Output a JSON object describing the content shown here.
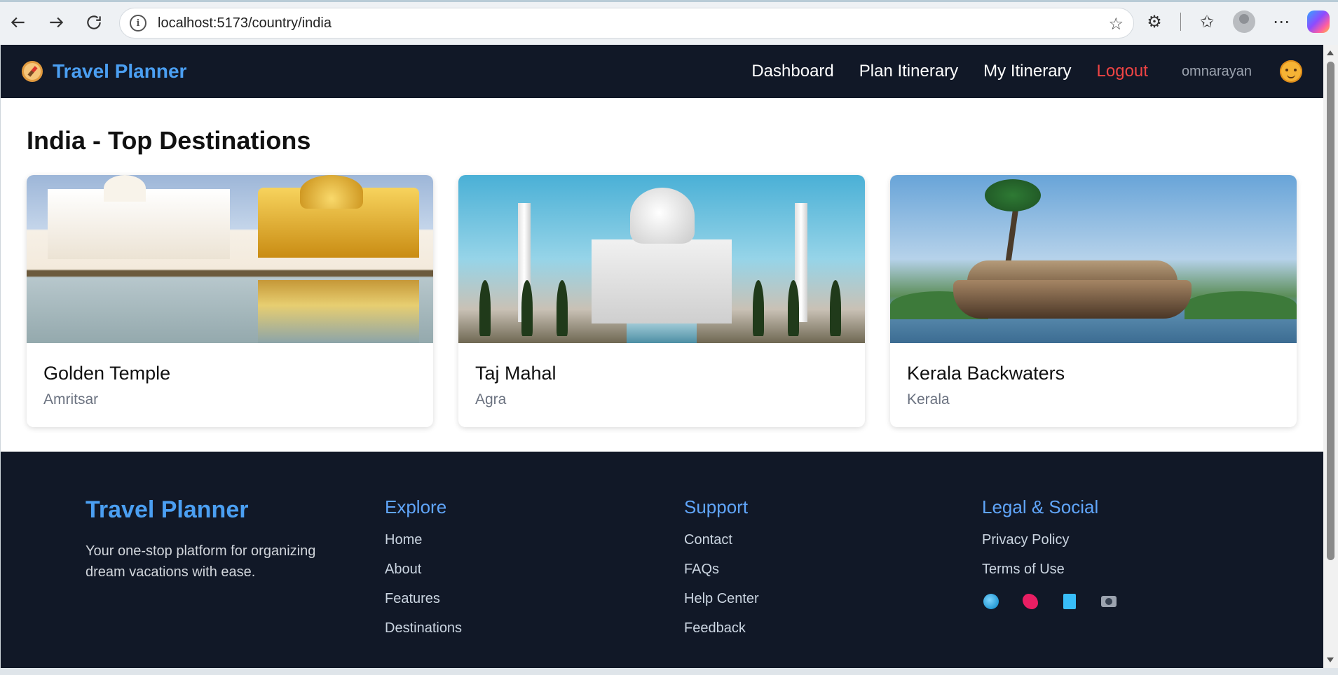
{
  "browser": {
    "url": "localhost:5173/country/india"
  },
  "app_nav": {
    "brand": "Travel Planner",
    "links": [
      {
        "label": "Dashboard"
      },
      {
        "label": "Plan Itinerary"
      },
      {
        "label": "My Itinerary"
      }
    ],
    "logout_label": "Logout",
    "username": "omnarayan",
    "colors": {
      "brand": "#4b9ff2",
      "logout": "#ef4444",
      "nav_bg": "#111827"
    }
  },
  "page": {
    "title": "India - Top Destinations"
  },
  "destinations": [
    {
      "name": "Golden Temple",
      "location": "Amritsar"
    },
    {
      "name": "Taj Mahal",
      "location": "Agra"
    },
    {
      "name": "Kerala Backwaters",
      "location": "Kerala"
    }
  ],
  "footer": {
    "brand": "Travel Planner",
    "tagline": "Your one-stop platform for organizing dream vacations with ease.",
    "columns": [
      {
        "heading": "Explore",
        "links": [
          "Home",
          "About",
          "Features",
          "Destinations"
        ]
      },
      {
        "heading": "Support",
        "links": [
          "Contact",
          "FAQs",
          "Help Center",
          "Feedback"
        ]
      },
      {
        "heading": "Legal & Social",
        "links": [
          "Privacy Policy",
          "Terms of Use"
        ]
      }
    ],
    "social_icons": [
      "globe-icon",
      "bird-icon",
      "book-icon",
      "camera-icon"
    ]
  }
}
